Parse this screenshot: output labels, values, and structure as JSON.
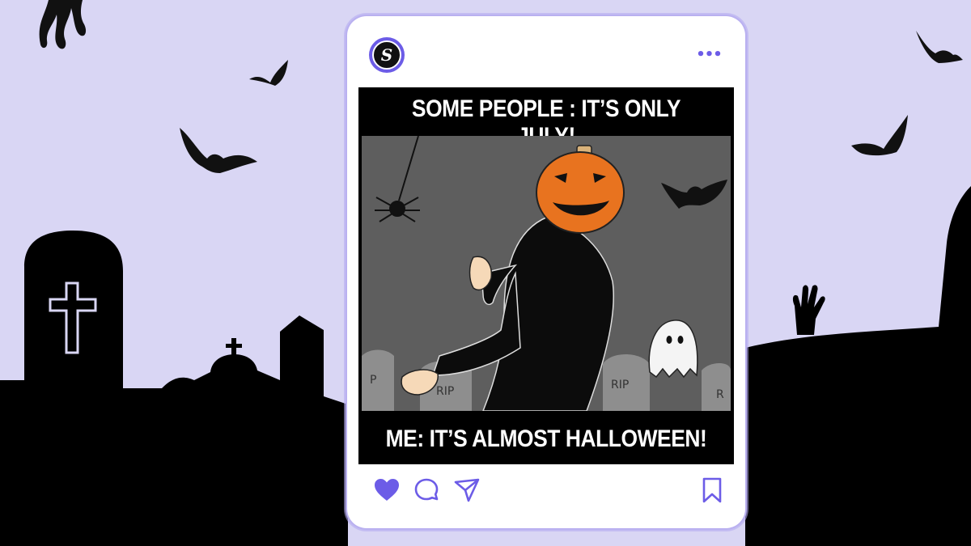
{
  "post": {
    "avatar_letter": "S",
    "more_label": "•••",
    "meme_top_text": "SOME PEOPLE : IT’S ONLY JULY!",
    "meme_bottom_text": "ME: IT’S ALMOST HALLOWEEN!",
    "tombstone_texts": [
      "P",
      "RIP",
      "RIP",
      "R"
    ]
  },
  "actions": {
    "icons": [
      "heart-icon",
      "comment-icon",
      "share-icon",
      "bookmark-icon"
    ],
    "liked": true
  },
  "colors": {
    "accent": "#6c5ce7",
    "background": "#d9d6f4",
    "silhouette": "#000000",
    "pumpkin": "#e8731f"
  }
}
